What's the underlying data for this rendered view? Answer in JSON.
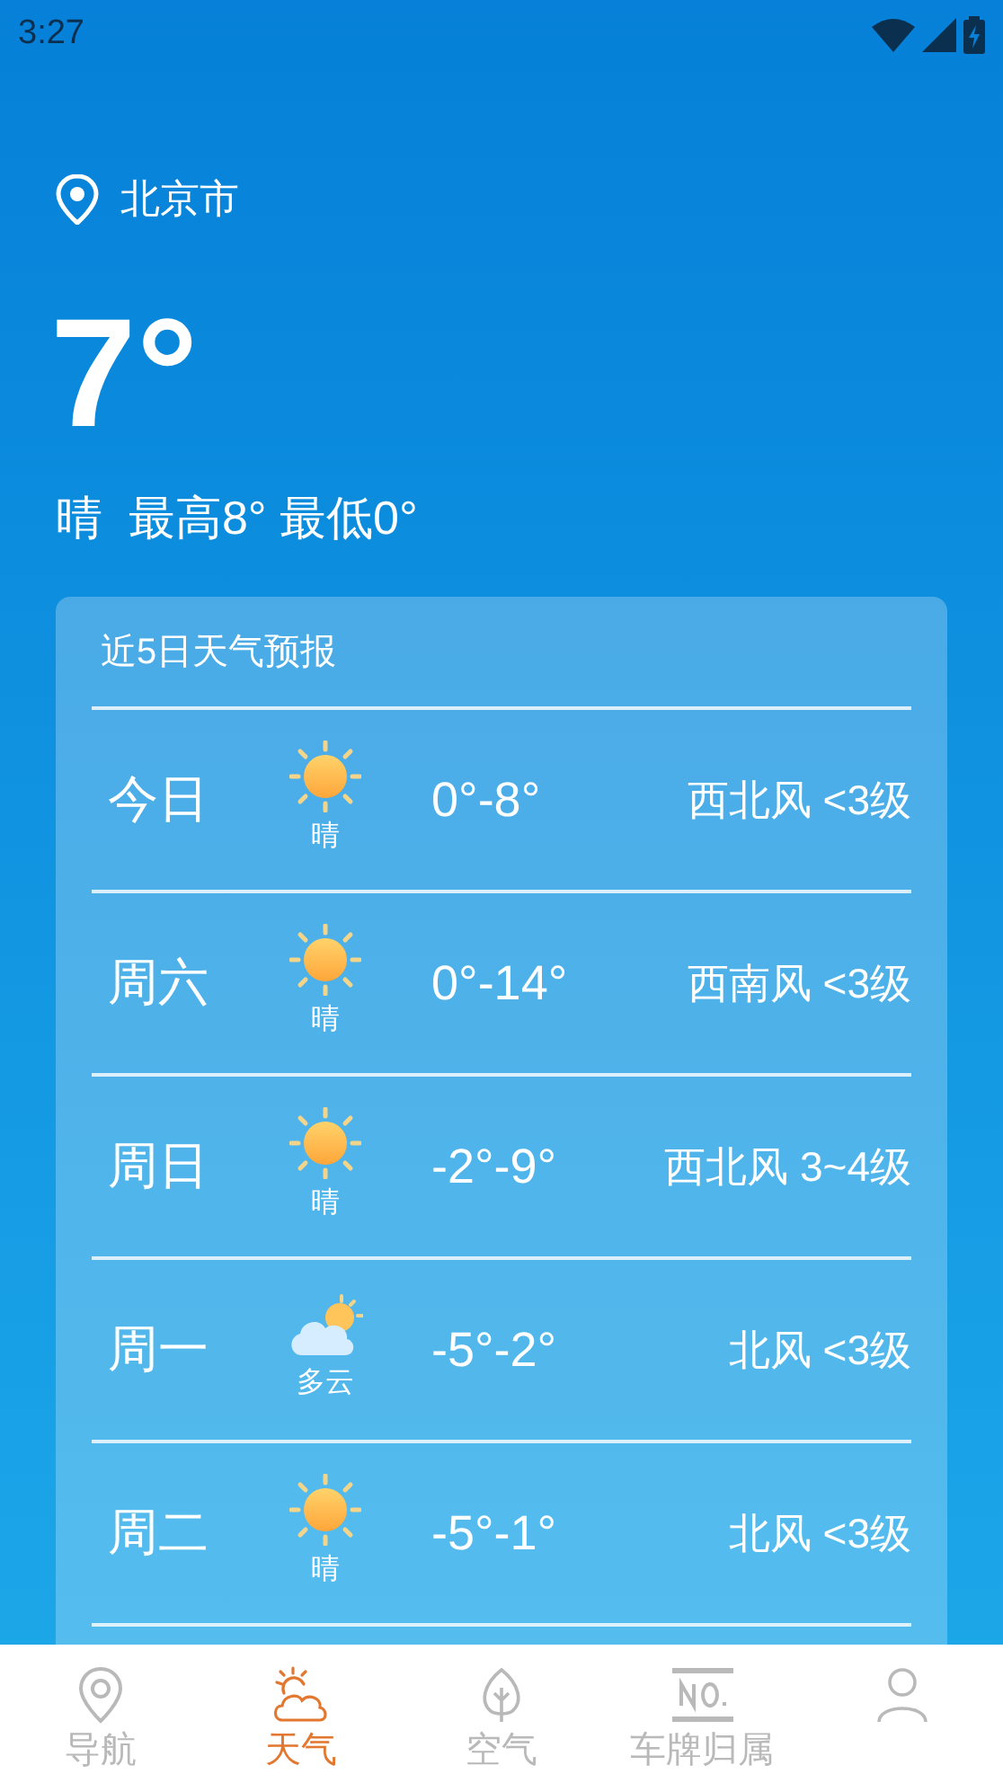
{
  "status_bar": {
    "time": "3:27"
  },
  "location": "北京市",
  "current": {
    "temperature": "7°",
    "summary": "晴  最高8° 最低0°"
  },
  "forecast": {
    "title": "近5日天气预报",
    "days": [
      {
        "day": "今日",
        "kind": "sunny",
        "condition": "晴",
        "temps": "0°-8°",
        "wind": "西北风 <3级"
      },
      {
        "day": "周六",
        "kind": "sunny",
        "condition": "晴",
        "temps": "0°-14°",
        "wind": "西南风 <3级"
      },
      {
        "day": "周日",
        "kind": "sunny",
        "condition": "晴",
        "temps": "-2°-9°",
        "wind": "西北风 3~4级"
      },
      {
        "day": "周一",
        "kind": "cloudy",
        "condition": "多云",
        "temps": "-5°-2°",
        "wind": "北风 <3级"
      },
      {
        "day": "周二",
        "kind": "sunny",
        "condition": "晴",
        "temps": "-5°-1°",
        "wind": "北风 <3级"
      }
    ]
  },
  "bottom_nav": [
    {
      "kind": "pin",
      "label": "导航",
      "selected": false
    },
    {
      "kind": "weather",
      "label": "天气",
      "selected": true
    },
    {
      "kind": "leaf",
      "label": "空气",
      "selected": false
    },
    {
      "kind": "plate",
      "label": "车牌归属",
      "selected": false
    },
    {
      "kind": "person",
      "selected": false
    }
  ]
}
